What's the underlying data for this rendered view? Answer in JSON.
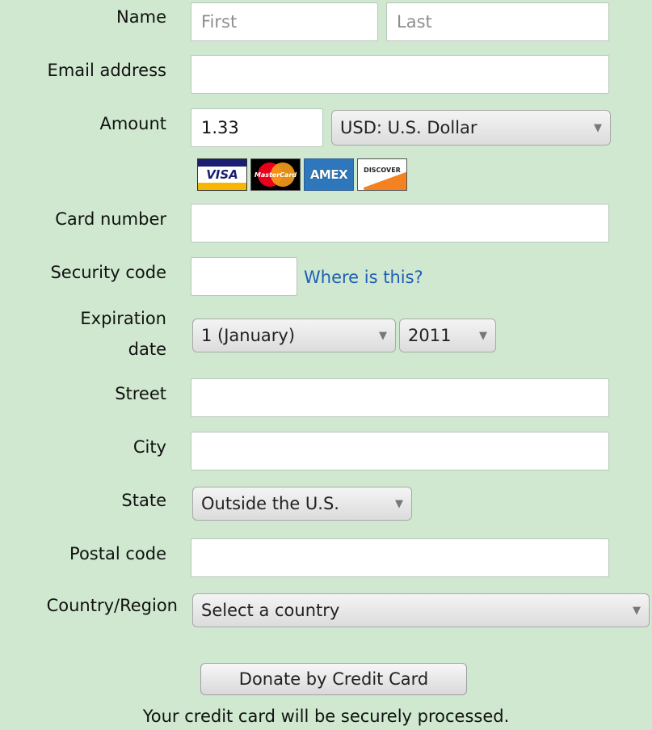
{
  "labels": {
    "name": "Name",
    "email": "Email address",
    "amount": "Amount",
    "card_number": "Card number",
    "security_code": "Security code",
    "expiration_1": "Expiration",
    "expiration_2": "date",
    "street": "Street",
    "city": "City",
    "state": "State",
    "postal": "Postal code",
    "country": "Country/Region"
  },
  "name": {
    "first_placeholder": "First",
    "last_placeholder": "Last"
  },
  "amount": {
    "value": "1.33",
    "currency": "USD: U.S. Dollar"
  },
  "cards": {
    "visa": "VISA",
    "mastercard": "MasterCard",
    "amex": "AMEX",
    "discover": "DISCOVER"
  },
  "security": {
    "help_link": "Where is this?"
  },
  "expiration": {
    "month": "1 (January)",
    "year": "2011"
  },
  "state": {
    "selected": "Outside the U.S."
  },
  "country": {
    "selected": "Select a country"
  },
  "submit": {
    "label": "Donate by Credit Card"
  },
  "note": "Your credit card will be securely processed.",
  "icons": {
    "dropdown": "triangle-down"
  },
  "colors": {
    "background": "#cfe8cf",
    "link": "#1f5fb8"
  }
}
